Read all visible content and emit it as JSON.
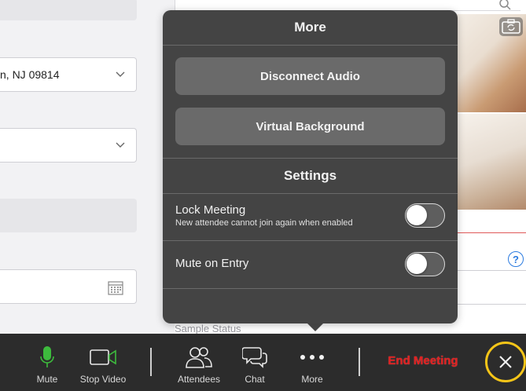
{
  "form": {
    "address_value": "n, NJ 09814"
  },
  "popover": {
    "title": "More",
    "disconnect_audio": "Disconnect Audio",
    "virtual_background": "Virtual Background",
    "settings_title": "Settings",
    "lock_meeting": {
      "label": "Lock Meeting",
      "description": "New attendee cannot join again when enabled",
      "enabled": false
    },
    "mute_on_entry": {
      "label": "Mute on Entry",
      "enabled": false
    }
  },
  "background": {
    "sample_status_label": "Sample Status",
    "help_glyph": "?"
  },
  "toolbar": {
    "mute": "Mute",
    "stop_video": "Stop Video",
    "attendees": "Attendees",
    "chat": "Chat",
    "more": "More",
    "end_meeting": "End Meeting"
  },
  "icons": {
    "mute": "microphone-icon",
    "stop_video": "video-camera-icon",
    "attendees": "people-icon",
    "chat": "chat-bubbles-icon",
    "more": "ellipsis-icon",
    "close": "close-icon",
    "search": "search-icon",
    "camera_flip": "camera-flip-icon",
    "help": "help-icon",
    "chevron": "chevron-down-icon",
    "calendar": "calendar-icon"
  },
  "colors": {
    "mic_accent": "#3dbb3d",
    "end_meeting": "#e02020",
    "close_ring": "#f5c518",
    "help": "#2b7be0"
  }
}
